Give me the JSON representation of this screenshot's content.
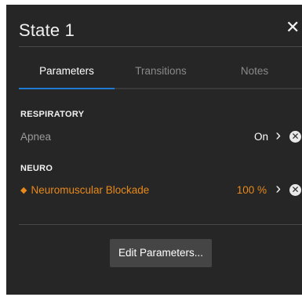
{
  "panel": {
    "title": "State 1",
    "close_glyph": "✕"
  },
  "tabs": [
    {
      "label": "Parameters",
      "active": true
    },
    {
      "label": "Transitions",
      "active": false
    },
    {
      "label": "Notes",
      "active": false
    }
  ],
  "sections": [
    {
      "title": "RESPIRATORY",
      "rows": [
        {
          "name": "Apnea",
          "value": "On",
          "modified": false
        }
      ]
    },
    {
      "title": "NEURO",
      "rows": [
        {
          "name": "Neuromuscular Blockade",
          "value": "100 %",
          "modified": true,
          "marker": "◆"
        }
      ]
    }
  ],
  "icons": {
    "chevron": "chevron-right-icon",
    "remove": "remove-circle-icon",
    "close": "close-icon"
  },
  "glyphs": {
    "chevron": "›",
    "remove": "✕"
  },
  "actions": {
    "edit_label": "Edit Parameters..."
  },
  "colors": {
    "panel_bg": "#262626",
    "accent_tab": "#1f7bd1",
    "modified": "#e8891a"
  }
}
